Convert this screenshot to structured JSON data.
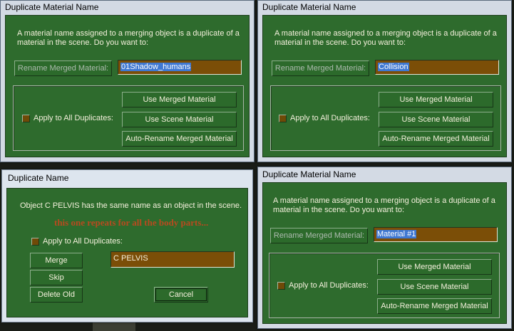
{
  "dialog_top_left": {
    "title": "Duplicate Material Name",
    "message_line1": "A material name assigned to a merging object is a duplicate of a",
    "message_line2": "material in the scene. Do you want to:",
    "rename_label": "Rename Merged Material:",
    "name_value": "01Shadow_humans",
    "apply_all_label": "Apply to All Duplicates:",
    "use_merged_label": "Use Merged Material",
    "use_scene_label": "Use Scene Material",
    "auto_rename_label": "Auto-Rename Merged Material"
  },
  "dialog_top_right": {
    "title": "Duplicate Material Name",
    "message_line1": "A material name assigned to a merging object is a duplicate of a",
    "message_line2": "material in the scene. Do you want to:",
    "rename_label": "Rename Merged Material:",
    "name_value": "Collision",
    "apply_all_label": "Apply to All Duplicates:",
    "use_merged_label": "Use Merged Material",
    "use_scene_label": "Use Scene Material",
    "auto_rename_label": "Auto-Rename Merged Material"
  },
  "dialog_bottom_left": {
    "title": "Duplicate Name",
    "message": "Object C PELVIS has the same name as an object in the scene.",
    "annotation": "this one repeats for all the body parts...",
    "apply_all_label": "Apply to All Duplicates:",
    "merge_label": "Merge",
    "skip_label": "Skip",
    "delete_old_label": "Delete Old",
    "name_value": "C PELVIS",
    "cancel_label": "Cancel"
  },
  "dialog_bottom_right": {
    "title": "Duplicate Material Name",
    "message_line1": "A material name assigned to a merging object is a duplicate of a",
    "message_line2": "material in the scene. Do you want to:",
    "rename_label": "Rename Merged Material:",
    "name_value": "Material #1",
    "apply_all_label": "Apply to All Duplicates:",
    "use_merged_label": "Use Merged Material",
    "use_scene_label": "Use Scene Material",
    "auto_rename_label": "Auto-Rename Merged Material"
  }
}
